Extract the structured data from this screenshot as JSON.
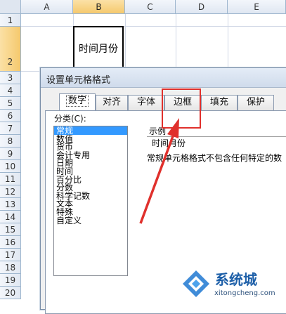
{
  "columns": [
    "A",
    "B",
    "C",
    "D",
    "E"
  ],
  "rows": [
    "1",
    "2",
    "3",
    "4",
    "5",
    "6",
    "7",
    "8",
    "9",
    "10",
    "11",
    "12",
    "13",
    "14",
    "15",
    "16",
    "17",
    "18",
    "19",
    "20"
  ],
  "cell_b2": "时间月份",
  "dialog": {
    "title": "设置单元格格式",
    "tabs": [
      "数字",
      "对齐",
      "字体",
      "边框",
      "填充",
      "保护"
    ],
    "category_label": "分类(C):",
    "categories": [
      "常规",
      "数值",
      "货币",
      "会计专用",
      "日期",
      "时间",
      "百分比",
      "分数",
      "科学记数",
      "文本",
      "特殊",
      "自定义"
    ],
    "selected_category": "常规",
    "sample_label": "示例",
    "sample_value": "时间月份",
    "description": "常规单元格格式不包含任何特定的数"
  },
  "annotation": {
    "highlighted_tab": "边框",
    "color": "#e0302c"
  },
  "watermark": {
    "name": "系统城",
    "url": "xitongcheng.com"
  }
}
